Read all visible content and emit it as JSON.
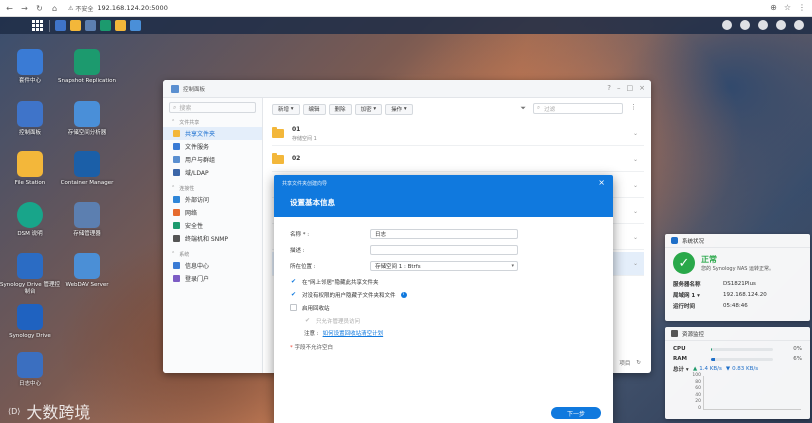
{
  "browser": {
    "back": "←",
    "forward": "→",
    "reload": "↻",
    "home": "⌂",
    "insecure_label": "不安全",
    "url": "192.168.124.20:5000"
  },
  "desktop_icons": [
    {
      "label": "套件中心",
      "color": "#3a7bd5"
    },
    {
      "label": "Snapshot Replication",
      "color": "#1c9a6e"
    },
    {
      "label": "控制面板",
      "color": "#3f74c9"
    },
    {
      "label": "存储空间分析器",
      "color": "#4a8fd8"
    },
    {
      "label": "File Station",
      "color": "#f3b73a"
    },
    {
      "label": "Container Manager",
      "color": "#1b5fa8"
    },
    {
      "label": "DSM 说明",
      "color": "#18a58a"
    },
    {
      "label": "存储管理器",
      "color": "#5c7fb0"
    },
    {
      "label": "Synology Drive 管理控制台",
      "color": "#2b6cc4"
    },
    {
      "label": "WebDAV Server",
      "color": "#4b8fd6"
    },
    {
      "label": "Synology Drive",
      "color": "#1f62c0"
    },
    {
      "label": "日志中心",
      "color": "#3b6fc0"
    }
  ],
  "control_panel": {
    "title": "控制面板",
    "search_placeholder": "搜索",
    "sections": [
      {
        "title": "文件共享",
        "items": [
          {
            "label": "共享文件夹",
            "active": true,
            "color": "#f3b73a"
          },
          {
            "label": "文件服务",
            "active": false,
            "color": "#3a7bd5"
          },
          {
            "label": "用户与群组",
            "active": false,
            "color": "#5a8fd0"
          },
          {
            "label": "域/LDAP",
            "active": false,
            "color": "#3c66a8"
          }
        ]
      },
      {
        "title": "连接性",
        "items": [
          {
            "label": "外部访问",
            "active": false,
            "color": "#2f86d8"
          },
          {
            "label": "网络",
            "active": false,
            "color": "#e66b2e"
          },
          {
            "label": "安全性",
            "active": false,
            "color": "#1c9a6e"
          },
          {
            "label": "终端机和 SNMP",
            "active": false,
            "color": "#555"
          }
        ]
      },
      {
        "title": "系统",
        "items": [
          {
            "label": "信息中心",
            "active": false,
            "color": "#3a7bd5"
          },
          {
            "label": "登录门户",
            "active": false,
            "color": "#7c5cc4"
          }
        ]
      }
    ],
    "toolbar": {
      "create": "新增",
      "edit": "编辑",
      "delete": "删除",
      "encrypt": "加密",
      "action": "操作",
      "filter_placeholder": "过滤"
    },
    "shares": [
      {
        "name": "01",
        "sub": "存储空间 1"
      },
      {
        "name": "02",
        "sub": ""
      }
    ],
    "footer": {
      "count": "项目"
    }
  },
  "wizard": {
    "small_title": "共享文件夹创建向导",
    "title": "设置基本信息",
    "name_label": "名称 * :",
    "name_value": "日志",
    "desc_label": "描述 :",
    "desc_value": "",
    "location_label": "所在位置 :",
    "location_value": "存储空间 1 : Btrfs",
    "opt_hide": "在\"网上邻居\"隐藏此共享文件夹",
    "opt_hide_perm": "对没有权限的用户隐藏子文件夹和文件",
    "opt_recycle": "启用回收站",
    "opt_admin_only": "只允许管理员访问",
    "note_prefix": "注意 :",
    "note_link": "如何设置回收站清空计划",
    "required_note": "字段不允许空白",
    "next": "下一步"
  },
  "system_widget": {
    "title": "系统状况",
    "status": "正常",
    "status_desc": "您的 Synology NAS 运转正常。",
    "rows": [
      {
        "k": "服务器名称",
        "v": "DS1821Plus"
      },
      {
        "k": "局域网 1",
        "v": "192.168.124.20"
      },
      {
        "k": "运行时间",
        "v": "05:48:46"
      }
    ]
  },
  "resource_widget": {
    "title": "资源监控",
    "cpu_label": "CPU",
    "cpu_pct": "0%",
    "cpu_value": 0.02,
    "ram_label": "RAM",
    "ram_pct": "6%",
    "ram_value": 0.06,
    "net_label": "总计",
    "up": "1.4 KB/s",
    "down": "0.83 KB/s",
    "yticks": [
      "100",
      "80",
      "60",
      "40",
      "20",
      "0"
    ]
  },
  "watermark": {
    "text": "大数跨境"
  }
}
